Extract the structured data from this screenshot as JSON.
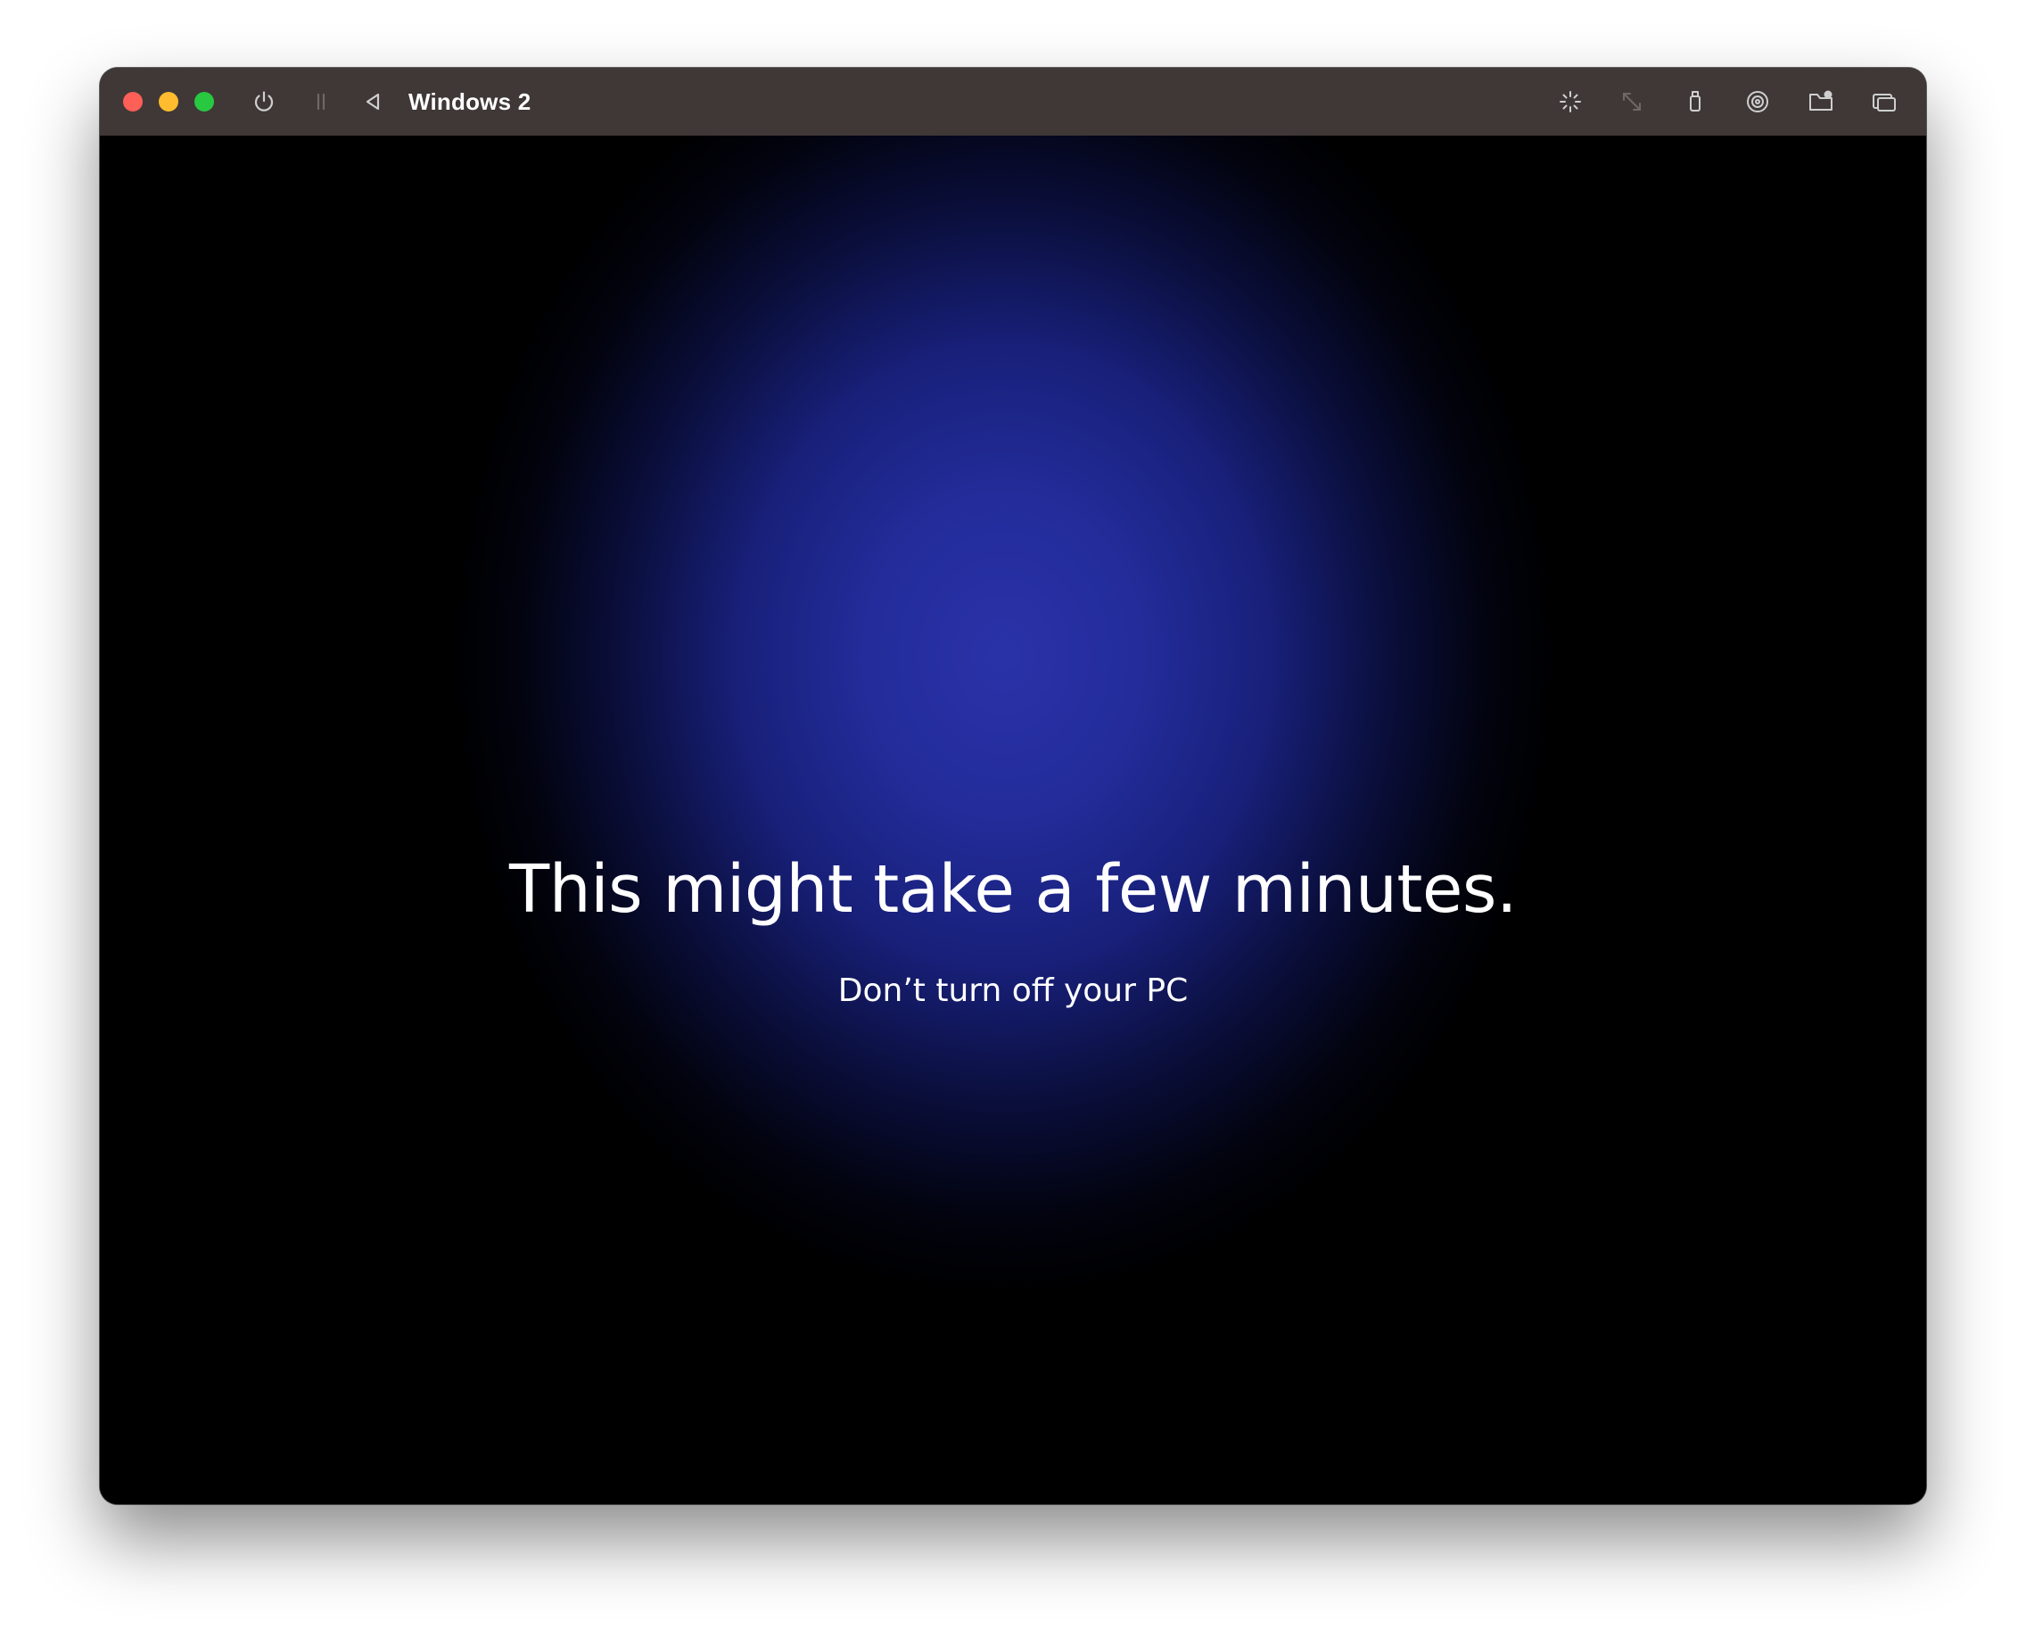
{
  "window": {
    "title": "Windows 2"
  },
  "toolbar": {
    "left_icons": [
      "power-icon",
      "pause-icon",
      "back-icon"
    ],
    "right_icons": [
      "brightness-icon",
      "resize-icon",
      "usb-icon",
      "disc-icon",
      "shared-folder-icon",
      "windows-icon"
    ]
  },
  "screen": {
    "headline": "This might take a few minutes.",
    "subline": "Don’t turn off your PC"
  },
  "colors": {
    "titlebar": "#3f3837",
    "close": "#fe5f57",
    "minimize": "#febc2e",
    "zoom": "#28c840",
    "glow": "#2a32a8"
  }
}
